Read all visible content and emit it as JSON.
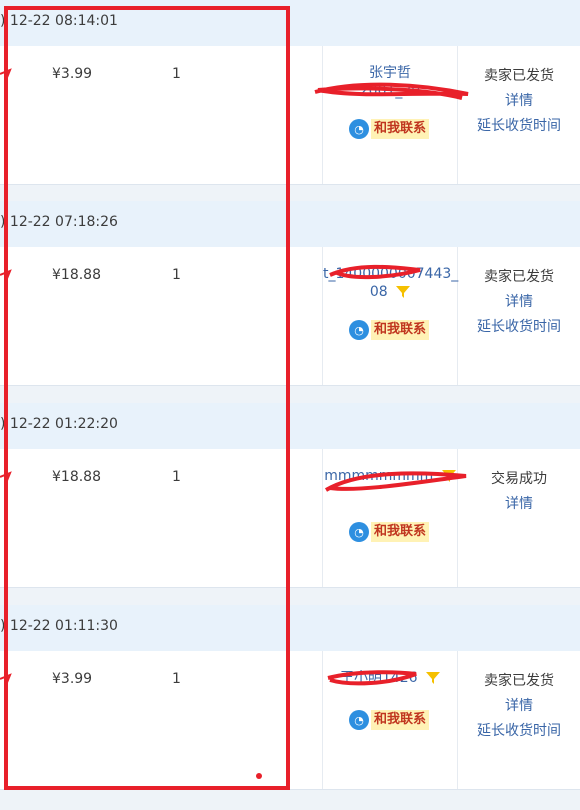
{
  "orders": [
    {
      "date": ") 12-22 08:14:01",
      "price": "¥3.99",
      "qty": "1",
      "buyer_line1": "张宇哲",
      "buyer_line2": "2001_20",
      "contact_label": "和我联系",
      "status": "卖家已发货",
      "detail_link": "详情",
      "extend_link": "延长收货时间"
    },
    {
      "date": ") 12-22 07:18:26",
      "price": "¥18.88",
      "qty": "1",
      "buyer_line1": "t_1400000007443_",
      "buyer_line2": "08",
      "contact_label": "和我联系",
      "status": "卖家已发货",
      "detail_link": "详情",
      "extend_link": "延长收货时间"
    },
    {
      "date": ") 12-22 01:22:20",
      "price": "¥18.88",
      "qty": "1",
      "buyer_line1": "",
      "buyer_line2": "mmmmmmmm",
      "contact_label": "和我联系",
      "status": "交易成功",
      "detail_link": "详情",
      "extend_link": ""
    },
    {
      "date": ") 12-22 01:11:30",
      "price": "¥3.99",
      "qty": "1",
      "buyer_line1": "王小明1426",
      "buyer_line2": "",
      "contact_label": "和我联系",
      "status": "卖家已发货",
      "detail_link": "详情",
      "extend_link": "延长收货时间"
    }
  ],
  "colors": {
    "header_bg": "#e8f2fb",
    "link": "#3a66a7",
    "annotation_red": "#e8202a",
    "contact_bg": "#fff2b5",
    "contact_text": "#c0351f",
    "contact_bubble": "#2e8fe0",
    "filter_icon": "#f5c000"
  },
  "icons": {
    "filter": "funnel-icon",
    "contact": "chat-bubble-icon"
  }
}
